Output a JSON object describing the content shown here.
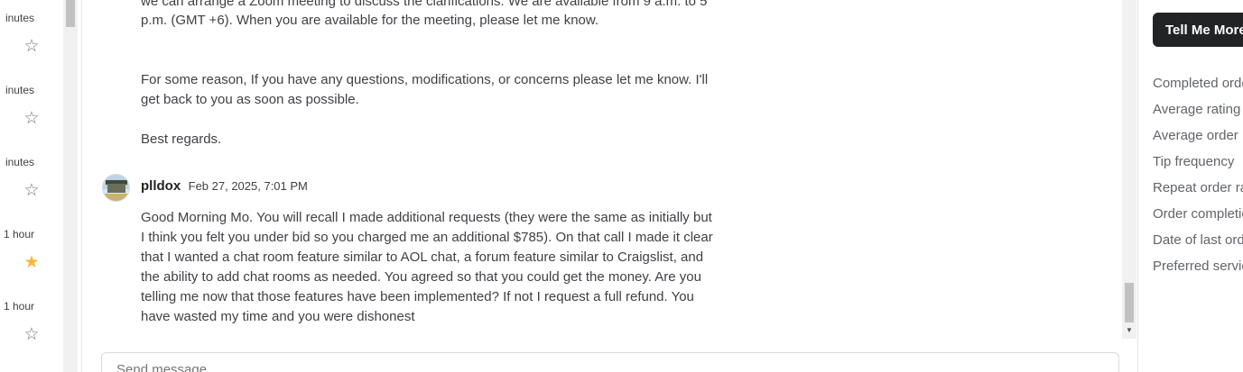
{
  "left_list": {
    "items": [
      {
        "time": "inutes",
        "starred": false
      },
      {
        "time": "inutes",
        "starred": false
      },
      {
        "time": "inutes",
        "starred": false
      },
      {
        "time": "1 hour",
        "starred": true
      },
      {
        "time": "1 hour",
        "starred": false
      }
    ],
    "star_glyph_empty": "☆",
    "star_glyph_filled": "★"
  },
  "conversation": {
    "prev_message": {
      "line1": "we can arrange a Zoom meeting to discuss the clarifications. We are available from 9 a.m. to 5",
      "line2": "p.m. (GMT +6). When you are available for the meeting, please let me know.",
      "para2": "For some reason, If you have any questions, modifications, or concerns please let me know. I'll get back to you as soon as possible.",
      "closing": "Best regards."
    },
    "message": {
      "sender": "plldox",
      "timestamp": "Feb 27, 2025, 7:01 PM",
      "body": "Good Morning Mo. You will recall I made additional requests (they were the same as initially but I think you felt you under bid so you charged me an additional $785). On that call I made it clear that I wanted a chat room feature similar to AOL chat, a forum feature similar to Craigslist, and the ability to add chat rooms as needed. You agreed so that you could get the money. Are you telling me now that those features have been implemented? If not I request a full refund. You have wasted my time and you were dishonest"
    }
  },
  "send_box": {
    "placeholder": "Send message..."
  },
  "right_panel": {
    "button_label": "Tell Me More",
    "stats": [
      "Completed orders",
      "Average rating",
      "Average order",
      "Tip frequency",
      "Repeat order rate",
      "Order completion",
      "Date of last order",
      "Preferred service"
    ]
  },
  "colors": {
    "accent_star": "#ffb33e",
    "button_bg": "#222325",
    "text": "#404145"
  }
}
